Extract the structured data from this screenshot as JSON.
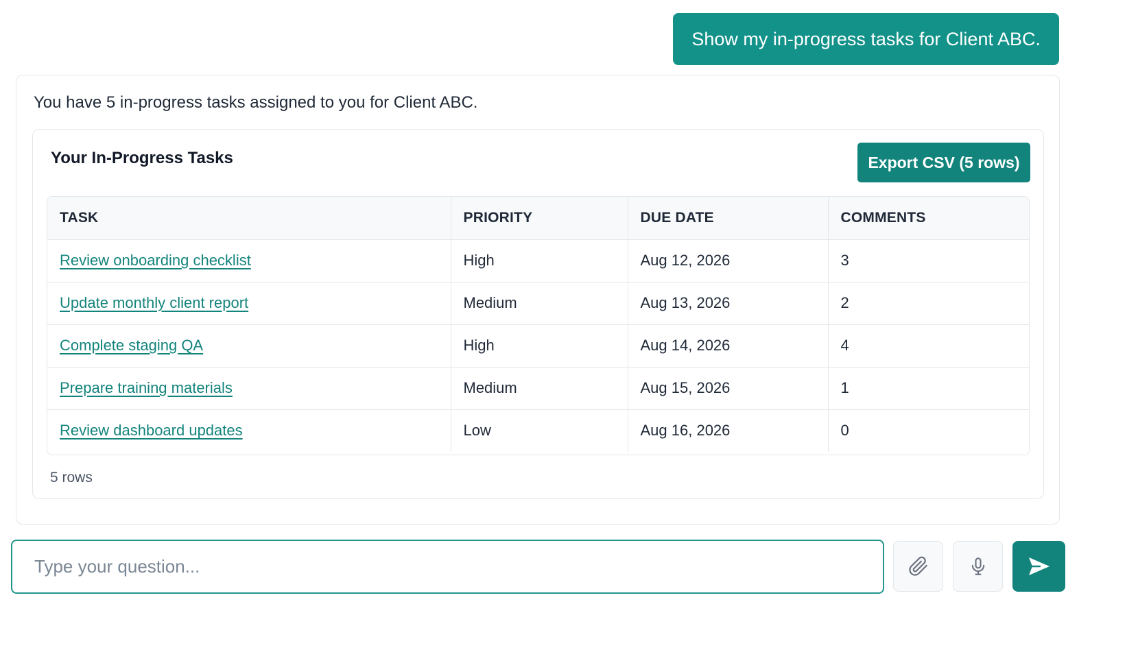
{
  "conversation": {
    "user_message": "Show my in-progress tasks for Client ABC.",
    "assistant_intro": "You have 5 in-progress tasks assigned to you for Client ABC."
  },
  "tasks_panel": {
    "title": "Your In-Progress Tasks",
    "export_label": "Export CSV (5 rows)",
    "columns": {
      "task": "TASK",
      "priority": "PRIORITY",
      "due_date": "DUE DATE",
      "comments": "COMMENTS"
    },
    "rows": [
      {
        "task": "Review onboarding checklist",
        "priority": "High",
        "due_date": "Aug 12, 2026",
        "comments": "3"
      },
      {
        "task": "Update monthly client report",
        "priority": "Medium",
        "due_date": "Aug 13, 2026",
        "comments": "2"
      },
      {
        "task": "Complete staging QA",
        "priority": "High",
        "due_date": "Aug 14, 2026",
        "comments": "4"
      },
      {
        "task": "Prepare training materials",
        "priority": "Medium",
        "due_date": "Aug 15, 2026",
        "comments": "1"
      },
      {
        "task": "Review dashboard updates",
        "priority": "Low",
        "due_date": "Aug 16, 2026",
        "comments": "0"
      }
    ],
    "row_count": "5 rows"
  },
  "composer": {
    "placeholder": "Type your question...",
    "value": "",
    "icons": {
      "attach": "paperclip-icon",
      "mic": "microphone-icon",
      "send": "send-icon"
    }
  },
  "colors": {
    "accent": "#13928a",
    "accent_dark": "#13847c",
    "border": "#e2e7ea",
    "header_bg": "#f8f9fa"
  }
}
